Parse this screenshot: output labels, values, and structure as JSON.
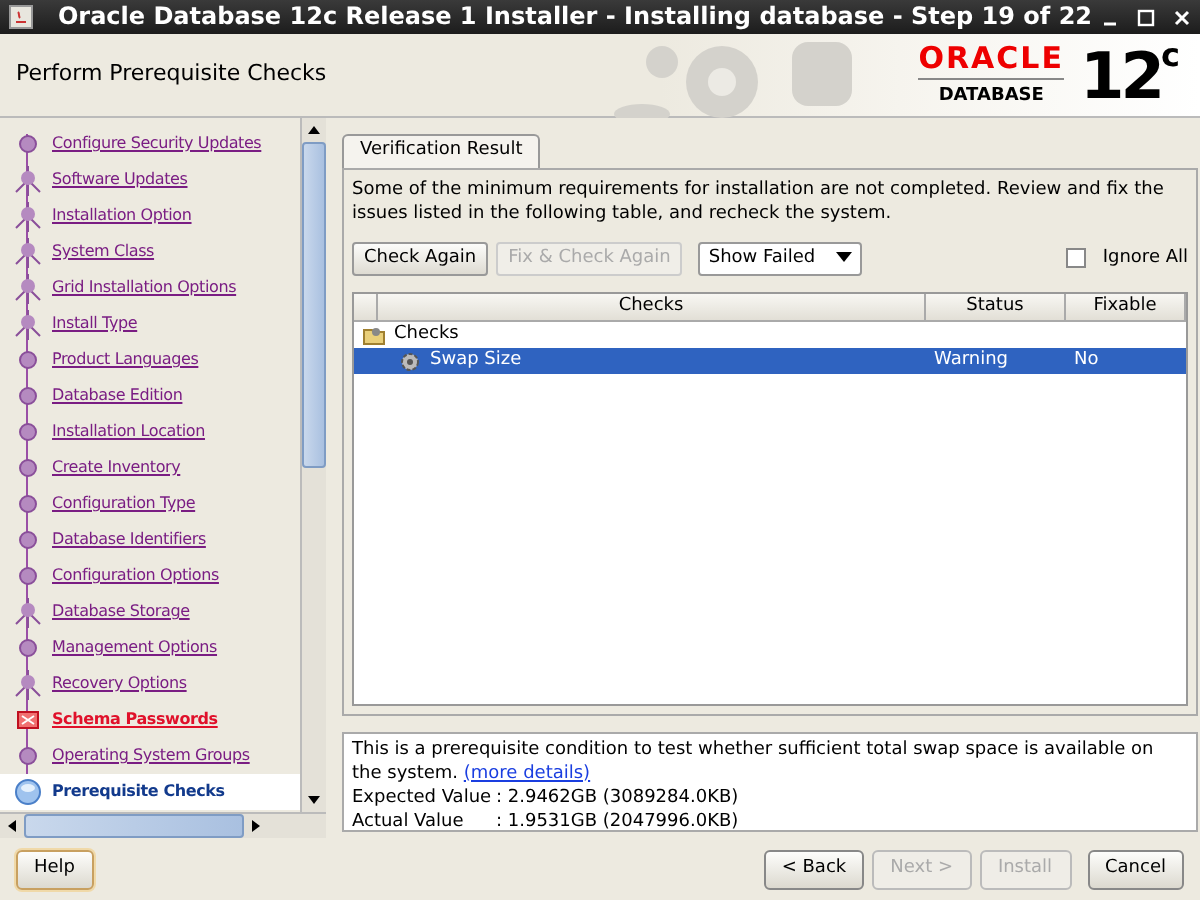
{
  "window": {
    "title": "Oracle Database 12c Release 1 Installer - Installing database - Step 19 of 22"
  },
  "header": {
    "title": "Perform Prerequisite Checks",
    "logo": {
      "brand": "ORACLE",
      "product": "DATABASE",
      "version": "12",
      "version_sup": "c"
    }
  },
  "steps": [
    {
      "label": "Configure Security Updates",
      "kind": "visited",
      "selected": false
    },
    {
      "label": "Software Updates",
      "kind": "skipped",
      "selected": false
    },
    {
      "label": "Installation Option",
      "kind": "skipped",
      "selected": false
    },
    {
      "label": "System Class",
      "kind": "skipped",
      "selected": false
    },
    {
      "label": "Grid Installation Options",
      "kind": "skipped",
      "selected": false
    },
    {
      "label": "Install Type",
      "kind": "skipped",
      "selected": false
    },
    {
      "label": "Product Languages",
      "kind": "visited",
      "selected": false
    },
    {
      "label": "Database Edition",
      "kind": "visited",
      "selected": false
    },
    {
      "label": "Installation Location",
      "kind": "visited",
      "selected": false
    },
    {
      "label": "Create Inventory",
      "kind": "visited",
      "selected": false
    },
    {
      "label": "Configuration Type",
      "kind": "visited",
      "selected": false
    },
    {
      "label": "Database Identifiers",
      "kind": "visited",
      "selected": false
    },
    {
      "label": "Configuration Options",
      "kind": "visited",
      "selected": false
    },
    {
      "label": "Database Storage",
      "kind": "skipped",
      "selected": false
    },
    {
      "label": "Management Options",
      "kind": "visited",
      "selected": false
    },
    {
      "label": "Recovery Options",
      "kind": "skipped",
      "selected": false
    },
    {
      "label": "Schema Passwords",
      "kind": "error",
      "selected": false
    },
    {
      "label": "Operating System Groups",
      "kind": "visited",
      "selected": false
    },
    {
      "label": "Prerequisite Checks",
      "kind": "current",
      "selected": true
    }
  ],
  "tabs": [
    {
      "label": "Verification Result",
      "selected": true
    }
  ],
  "message": "Some of the minimum requirements for installation are not completed. Review and fix the issues listed in the following table, and recheck the system.",
  "toolbar": {
    "buttons": [
      {
        "label": "Check Again",
        "disabled": false
      },
      {
        "label": "Fix & Check Again",
        "disabled": true
      }
    ],
    "filter": "Show Failed",
    "ignore_all": {
      "label": "Ignore All",
      "checked": false
    }
  },
  "table": {
    "columns": [
      "Checks",
      "Status",
      "Fixable"
    ],
    "rows": [
      {
        "label": "Checks",
        "status": "",
        "fixable": "",
        "selected": false,
        "children": [
          {
            "label": "Swap Size",
            "status": "Warning",
            "fixable": "No",
            "selected": true
          }
        ]
      }
    ]
  },
  "details": {
    "text": "This is a prerequisite condition to test whether sufficient total swap space is available on the system.",
    "link": "(more details)",
    "values": [
      {
        "label": "Expected Value",
        "value": ": 2.9462GB (3089284.0KB)"
      },
      {
        "label": "Actual Value",
        "value": ": 1.9531GB (2047996.0KB)"
      }
    ]
  },
  "footer": {
    "help": "Help",
    "buttons": [
      {
        "label": "< Back",
        "disabled": false
      },
      {
        "label": "Next >",
        "disabled": true
      },
      {
        "label": "Install",
        "disabled": true
      },
      {
        "label": "Cancel",
        "disabled": false
      }
    ]
  }
}
